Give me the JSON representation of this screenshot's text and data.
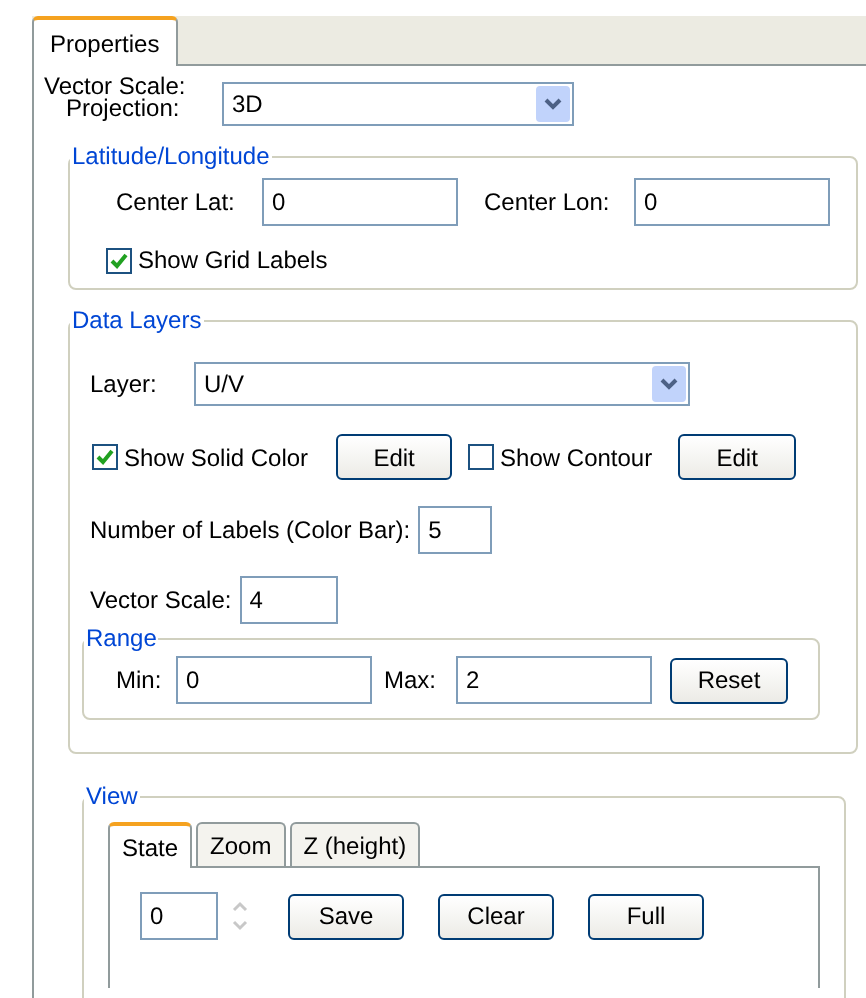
{
  "tabs": [
    {
      "label": "Properties",
      "selected": true
    }
  ],
  "vector_scale_heading": "Vector Scale:",
  "projection": {
    "label": "Projection:",
    "value": "3D"
  },
  "lat_lon": {
    "title": "Latitude/Longitude",
    "center_lat": {
      "label": "Center Lat:",
      "value": "0"
    },
    "center_lon": {
      "label": "Center Lon:",
      "value": "0"
    },
    "show_grid_labels": {
      "label": "Show Grid Labels",
      "checked": true
    }
  },
  "data_layers": {
    "title": "Data Layers",
    "layer": {
      "label": "Layer:",
      "value": "U/V"
    },
    "show_solid_color": {
      "label": "Show Solid Color",
      "checked": true,
      "button": "Edit"
    },
    "show_contour": {
      "label": "Show Contour",
      "checked": false,
      "button": "Edit"
    },
    "num_labels": {
      "label": "Number of Labels (Color Bar):",
      "value": "5"
    },
    "vector_scale": {
      "label": "Vector Scale:",
      "value": "4"
    },
    "range": {
      "title": "Range",
      "min": {
        "label": "Min:",
        "value": "0"
      },
      "max": {
        "label": "Max:",
        "value": "2"
      },
      "button": "Reset"
    }
  },
  "view": {
    "title": "View",
    "tabs": [
      {
        "label": "State",
        "selected": true
      },
      {
        "label": "Zoom",
        "selected": false
      },
      {
        "label": "Z (height)",
        "selected": false
      }
    ],
    "state_value": "0",
    "buttons": [
      "Save",
      "Clear",
      "Full"
    ]
  }
}
